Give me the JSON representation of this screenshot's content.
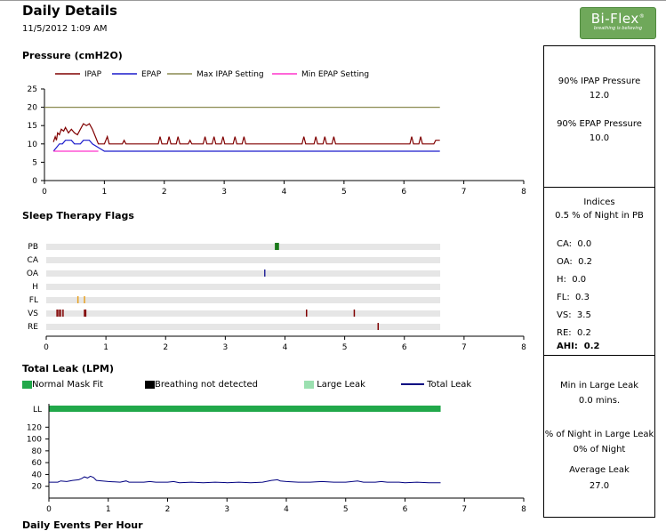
{
  "header": {
    "title": "Daily Details",
    "date": "11/5/2012 1:09 AM",
    "logo_brand": "Bi-Flex",
    "logo_tagline": "breathing is believing"
  },
  "sections": {
    "pressure": "Pressure (cmH2O)",
    "flags": "Sleep Therapy Flags",
    "leak": "Total Leak (LPM)",
    "events": "Daily Events Per Hour"
  },
  "colors": {
    "ipap": "#800000",
    "epap": "#1a1acc",
    "max_ipap": "#8a8a50",
    "min_epap": "#ff33cc",
    "normal_fit": "#21a84a",
    "breathing_not_detected": "#000000",
    "large_leak": "#9be0b0",
    "total_leak": "#000080"
  },
  "side_panel": {
    "pressure": {
      "ipap_label": "90% IPAP Pressure",
      "ipap_value": "12.0",
      "epap_label": "90% EPAP Pressure",
      "epap_value": "10.0"
    },
    "indices": {
      "title": "Indices",
      "pb": "0.5 % of Night in PB",
      "items": [
        {
          "label": "CA:",
          "value": "0.0"
        },
        {
          "label": "OA:",
          "value": "0.2"
        },
        {
          "label": "H:",
          "value": "0.0"
        },
        {
          "label": "FL:",
          "value": "0.3"
        },
        {
          "label": "VS:",
          "value": "3.5"
        },
        {
          "label": "RE:",
          "value": "0.2"
        }
      ],
      "ahi_label": "AHI:",
      "ahi_value": "0.2"
    },
    "leak": {
      "min_label": "Min in Large Leak",
      "min_value": "0.0 mins.",
      "pct_label": "% of Night in Large Leak",
      "pct_value": "0% of Night",
      "avg_label": "Average Leak",
      "avg_value": "27.0"
    }
  },
  "chart_data": [
    {
      "type": "line",
      "legend": [
        "IPAP",
        "EPAP",
        "Max IPAP Setting",
        "Min EPAP Setting"
      ],
      "xlim": [
        0,
        8
      ],
      "ylim": [
        0,
        25
      ],
      "xticks": [
        "0",
        "1",
        "2",
        "3",
        "4",
        "5",
        "6",
        "7",
        "8"
      ],
      "yticks": [
        "0",
        "5",
        "10",
        "15",
        "20",
        "25"
      ],
      "series": [
        {
          "name": "IPAP",
          "points": [
            [
              0.15,
              10.5
            ],
            [
              0.18,
              12
            ],
            [
              0.2,
              11
            ],
            [
              0.22,
              13
            ],
            [
              0.25,
              12.5
            ],
            [
              0.28,
              14
            ],
            [
              0.32,
              13.5
            ],
            [
              0.35,
              14.5
            ],
            [
              0.4,
              13
            ],
            [
              0.45,
              14
            ],
            [
              0.5,
              13
            ],
            [
              0.55,
              12.5
            ],
            [
              0.6,
              14
            ],
            [
              0.65,
              15.5
            ],
            [
              0.7,
              15
            ],
            [
              0.75,
              15.5
            ],
            [
              0.8,
              14
            ],
            [
              0.85,
              12
            ],
            [
              0.9,
              10
            ],
            [
              1.0,
              10
            ],
            [
              1.05,
              12
            ],
            [
              1.08,
              10
            ],
            [
              1.3,
              10
            ],
            [
              1.33,
              11
            ],
            [
              1.36,
              10
            ],
            [
              1.9,
              10
            ],
            [
              1.93,
              12
            ],
            [
              1.96,
              10
            ],
            [
              2.05,
              10
            ],
            [
              2.08,
              12
            ],
            [
              2.11,
              10
            ],
            [
              2.2,
              10
            ],
            [
              2.23,
              12
            ],
            [
              2.26,
              10
            ],
            [
              2.4,
              10
            ],
            [
              2.43,
              11
            ],
            [
              2.46,
              10
            ],
            [
              2.65,
              10
            ],
            [
              2.68,
              12
            ],
            [
              2.71,
              10
            ],
            [
              2.8,
              10
            ],
            [
              2.83,
              12
            ],
            [
              2.86,
              10
            ],
            [
              2.95,
              10
            ],
            [
              2.98,
              12
            ],
            [
              3.01,
              10
            ],
            [
              3.15,
              10
            ],
            [
              3.18,
              12
            ],
            [
              3.21,
              10
            ],
            [
              3.3,
              10
            ],
            [
              3.33,
              12
            ],
            [
              3.36,
              10
            ],
            [
              4.3,
              10
            ],
            [
              4.33,
              12
            ],
            [
              4.36,
              10
            ],
            [
              4.5,
              10
            ],
            [
              4.53,
              12
            ],
            [
              4.56,
              10
            ],
            [
              4.65,
              10
            ],
            [
              4.68,
              12
            ],
            [
              4.71,
              10
            ],
            [
              4.8,
              10
            ],
            [
              4.83,
              12
            ],
            [
              4.86,
              10
            ],
            [
              6.1,
              10
            ],
            [
              6.13,
              12
            ],
            [
              6.16,
              10
            ],
            [
              6.25,
              10
            ],
            [
              6.28,
              12
            ],
            [
              6.31,
              10
            ],
            [
              6.5,
              10
            ],
            [
              6.53,
              11
            ],
            [
              6.6,
              11
            ]
          ]
        },
        {
          "name": "EPAP",
          "points": [
            [
              0.15,
              8
            ],
            [
              0.2,
              9
            ],
            [
              0.25,
              10
            ],
            [
              0.3,
              10
            ],
            [
              0.35,
              11
            ],
            [
              0.45,
              11
            ],
            [
              0.5,
              10
            ],
            [
              0.6,
              10
            ],
            [
              0.65,
              11
            ],
            [
              0.75,
              11
            ],
            [
              0.8,
              10
            ],
            [
              0.9,
              9
            ],
            [
              1.0,
              8
            ],
            [
              6.6,
              8
            ]
          ]
        },
        {
          "name": "Max IPAP Setting",
          "points": [
            [
              0,
              20
            ],
            [
              6.6,
              20
            ]
          ]
        },
        {
          "name": "Min EPAP Setting",
          "points": [
            [
              0.15,
              8
            ],
            [
              0.9,
              8
            ]
          ]
        }
      ]
    },
    {
      "type": "scatter",
      "categories": [
        "PB",
        "CA",
        "OA",
        "H",
        "FL",
        "VS",
        "RE"
      ],
      "xlim": [
        0,
        8
      ],
      "xticks": [
        "0",
        "1",
        "2",
        "3",
        "4",
        "5",
        "6",
        "7",
        "8"
      ],
      "events": {
        "PB": [
          {
            "start": 3.83,
            "end": 3.9,
            "color": "#1a7a1a"
          }
        ],
        "CA": [],
        "OA": [
          {
            "start": 3.65,
            "color": "#2a2a9a"
          }
        ],
        "H": [],
        "FL": [
          {
            "start": 0.52,
            "color": "#e8a020"
          },
          {
            "start": 0.63,
            "color": "#e8a020"
          }
        ],
        "VS": [
          {
            "start": 0.17,
            "color": "#800000"
          },
          {
            "start": 0.2,
            "color": "#800000"
          },
          {
            "start": 0.23,
            "color": "#800000"
          },
          {
            "start": 0.27,
            "color": "#800000"
          },
          {
            "start": 0.63,
            "color": "#800000"
          },
          {
            "start": 0.65,
            "color": "#800000"
          },
          {
            "start": 4.35,
            "color": "#800000"
          },
          {
            "start": 5.15,
            "color": "#800000"
          }
        ],
        "RE": [
          {
            "start": 5.55,
            "color": "#800000"
          }
        ]
      }
    },
    {
      "type": "line",
      "legend": [
        "Normal Mask Fit",
        "Breathing not detected",
        "Large Leak",
        "Total Leak"
      ],
      "xlim": [
        0,
        8
      ],
      "ylim": [
        0,
        140
      ],
      "xticks": [
        "0",
        "1",
        "2",
        "3",
        "4",
        "5",
        "6",
        "7",
        "8"
      ],
      "yticks": [
        "20",
        "40",
        "60",
        "80",
        "100",
        "120"
      ],
      "top_label": "LL",
      "normal_fit": [
        0,
        6.6
      ],
      "series": [
        {
          "name": "Total Leak",
          "points": [
            [
              0,
              27
            ],
            [
              0.15,
              27
            ],
            [
              0.2,
              29
            ],
            [
              0.3,
              28
            ],
            [
              0.4,
              30
            ],
            [
              0.5,
              31
            ],
            [
              0.55,
              33
            ],
            [
              0.6,
              36
            ],
            [
              0.65,
              34
            ],
            [
              0.7,
              37
            ],
            [
              0.75,
              35
            ],
            [
              0.8,
              30
            ],
            [
              0.9,
              29
            ],
            [
              1.0,
              28
            ],
            [
              1.2,
              27
            ],
            [
              1.3,
              29
            ],
            [
              1.35,
              27
            ],
            [
              1.6,
              27
            ],
            [
              1.7,
              28
            ],
            [
              1.8,
              27
            ],
            [
              2.0,
              27
            ],
            [
              2.1,
              28
            ],
            [
              2.2,
              26
            ],
            [
              2.4,
              27
            ],
            [
              2.6,
              26
            ],
            [
              2.8,
              27
            ],
            [
              3.0,
              26
            ],
            [
              3.2,
              27
            ],
            [
              3.4,
              26
            ],
            [
              3.6,
              27
            ],
            [
              3.75,
              30
            ],
            [
              3.85,
              31
            ],
            [
              3.9,
              29
            ],
            [
              4.0,
              28
            ],
            [
              4.2,
              27
            ],
            [
              4.4,
              27
            ],
            [
              4.6,
              28
            ],
            [
              4.8,
              27
            ],
            [
              5.0,
              27
            ],
            [
              5.2,
              29
            ],
            [
              5.3,
              27
            ],
            [
              5.5,
              27
            ],
            [
              5.6,
              28
            ],
            [
              5.7,
              27
            ],
            [
              5.9,
              27
            ],
            [
              6.0,
              26
            ],
            [
              6.2,
              27
            ],
            [
              6.4,
              26
            ],
            [
              6.6,
              26
            ]
          ]
        }
      ]
    }
  ]
}
